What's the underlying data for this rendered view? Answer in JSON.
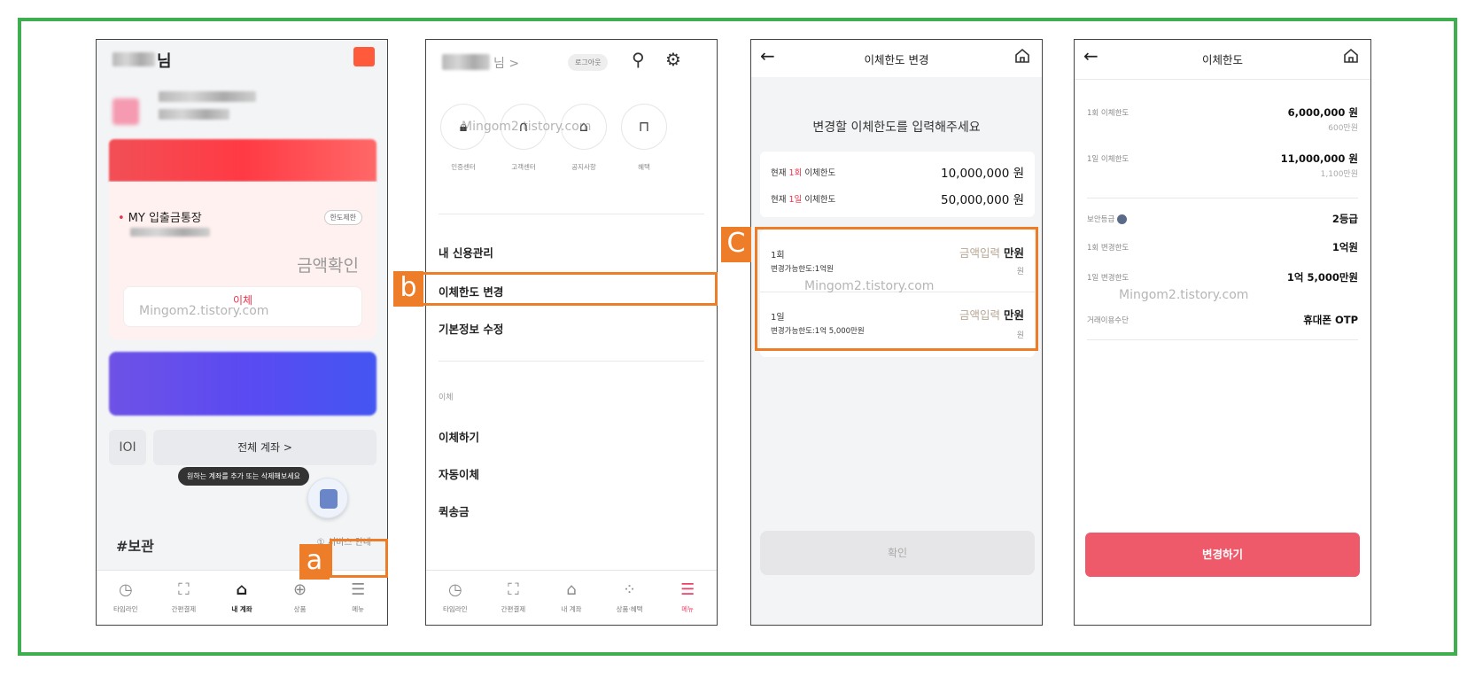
{
  "colors": {
    "frame": "#3fae4f",
    "marker": "#ee7d2a",
    "accent_red": "#e8334b",
    "accent_pink": "#ee3f6a",
    "change_button": "#ef5a6b"
  },
  "watermark": "Mingom2.tistory.com",
  "markers": {
    "a": "a",
    "b": "b",
    "c": "C"
  },
  "screen1": {
    "greeting_suffix": "님",
    "account_name": "MY 입출금통장",
    "limit_badge": "한도제한",
    "amount_check": "금액확인",
    "transfer_button": "이체",
    "account_icon": "IOI",
    "all_accounts": "전체 계좌 >",
    "tooltip": "원하는 계좌를 추가 또는 삭제해보세요",
    "section_title": "#보관",
    "guide_link": "① 서비스 안내",
    "tabs": [
      {
        "icon": "clock-icon",
        "label": "타임라인"
      },
      {
        "icon": "scan-icon",
        "label": "간편결제"
      },
      {
        "icon": "home-icon",
        "label": "내 계좌"
      },
      {
        "icon": "plus-circle-icon",
        "label": "상품"
      },
      {
        "icon": "menu-icon",
        "label": "메뉴"
      }
    ]
  },
  "screen2": {
    "greeting_suffix": "님 >",
    "logout": "로그아웃",
    "shortcuts": [
      {
        "icon": "lock-icon",
        "label": "인증센터"
      },
      {
        "icon": "headset-icon",
        "label": "고객센터"
      },
      {
        "icon": "bell-icon",
        "label": "공지사항"
      },
      {
        "icon": "gift-icon",
        "label": "혜택"
      }
    ],
    "menu_items": [
      "내 신용관리",
      "이체한도 변경",
      "기본정보 수정"
    ],
    "section_label": "이체",
    "transfer_items": [
      "이체하기",
      "자동이체",
      "퀵송금"
    ],
    "tabs": [
      {
        "icon": "clock-icon",
        "label": "타임라인"
      },
      {
        "icon": "scan-icon",
        "label": "간편결제"
      },
      {
        "icon": "home-icon",
        "label": "내 계좌"
      },
      {
        "icon": "dots-icon",
        "label": "상품·혜택"
      },
      {
        "icon": "menu-icon",
        "label": "메뉴"
      }
    ]
  },
  "screen3": {
    "title": "이체한도 변경",
    "prompt": "변경할 이체한도를 입력해주세요",
    "current": [
      {
        "prefix": "현재 ",
        "highlight": "1회",
        "suffix": " 이체한도",
        "value": "10,000,000 원"
      },
      {
        "prefix": "현재 ",
        "highlight": "1일",
        "suffix": " 이체한도",
        "value": "50,000,000 원"
      }
    ],
    "inputs": [
      {
        "label": "1회",
        "sub": "변경가능한도:1억원",
        "placeholder": "금액입력",
        "unit1": "만원",
        "unit2": "원"
      },
      {
        "label": "1일",
        "sub": "변경가능한도:1억 5,000만원",
        "placeholder": "금액입력",
        "unit1": "만원",
        "unit2": "원"
      }
    ],
    "confirm": "확인"
  },
  "screen4": {
    "title": "이체한도",
    "limits": [
      {
        "label": "1회 이체한도",
        "value": "6,000,000 원",
        "sub": "600만원"
      },
      {
        "label": "1일 이체한도",
        "value": "11,000,000 원",
        "sub": "1,100만원"
      }
    ],
    "details": [
      {
        "label": "보안등급",
        "value": "2등급"
      },
      {
        "label": "1회 변경한도",
        "value": "1억원"
      },
      {
        "label": "1일 변경한도",
        "value": "1억 5,000만원"
      },
      {
        "label": "거래이용수단",
        "value": "휴대폰 OTP"
      }
    ],
    "change_button": "변경하기"
  }
}
